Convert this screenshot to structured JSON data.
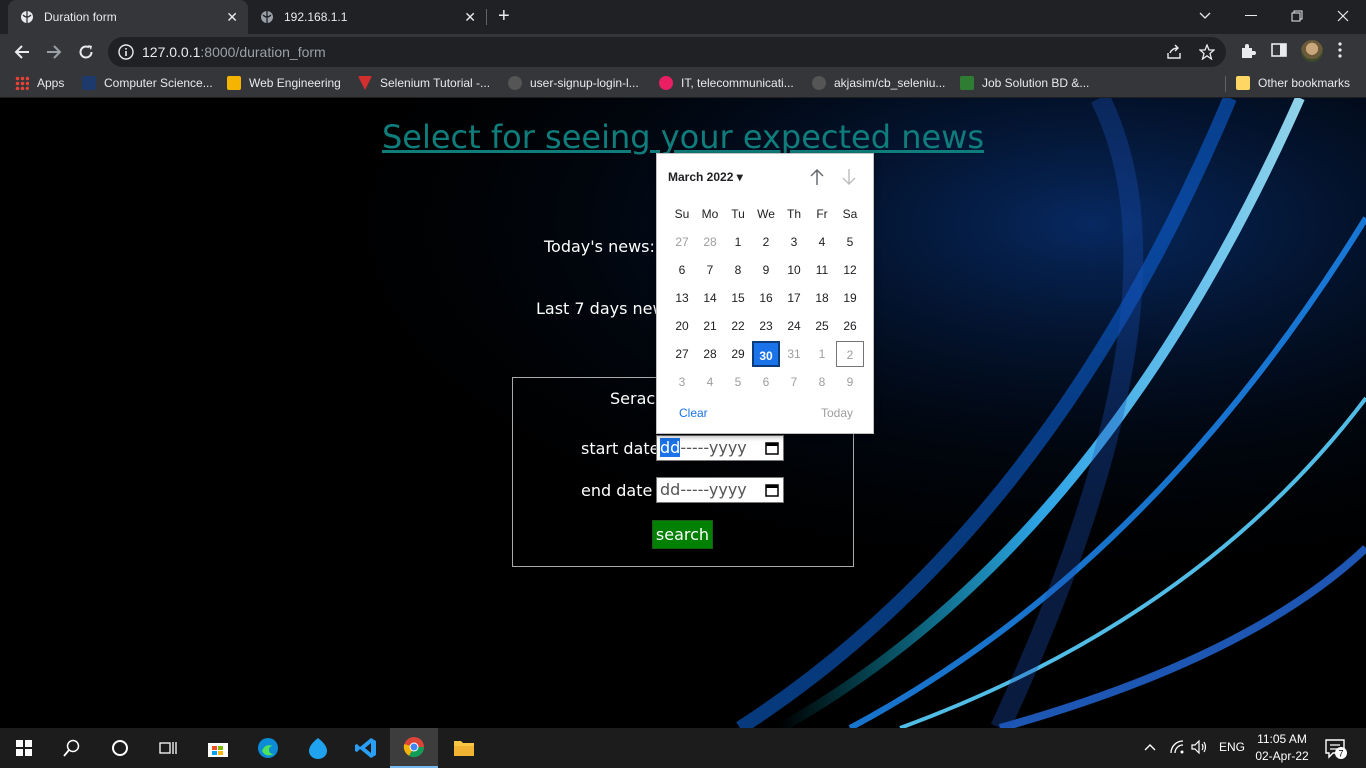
{
  "tabs": [
    {
      "title": "Duration form",
      "close": "✕"
    },
    {
      "title": "192.168.1.1",
      "close": "✕"
    }
  ],
  "new_tab": "+",
  "address": {
    "host": "127.0.0.1",
    "rest": ":8000/duration_form"
  },
  "bookmarks": [
    {
      "label": "Apps",
      "icon": "apps-grid-icon"
    },
    {
      "label": "Computer Science...",
      "icon": "sf-icon",
      "color": "#1e3a6d"
    },
    {
      "label": "Web Engineering",
      "icon": "classroom-icon",
      "color": "#f4b400"
    },
    {
      "label": "Selenium Tutorial -...",
      "icon": "v-icon",
      "color": "#d32f2f"
    },
    {
      "label": "user-signup-login-l...",
      "icon": "github-icon",
      "color": "#333333"
    },
    {
      "label": "IT, telecommunicati...",
      "icon": "it-icon",
      "color": "#e91e63"
    },
    {
      "label": "akjasim/cb_seleniu...",
      "icon": "github-icon",
      "color": "#333333"
    },
    {
      "label": "Job Solution BD &...",
      "icon": "job-icon",
      "color": "#2e7d32"
    }
  ],
  "other_bookmarks": "Other bookmarks",
  "page": {
    "title": "Select for seeing your expected news",
    "today_label": "Today's news:",
    "last7_label": "Last 7 days news:",
    "search_legend": "Serach",
    "start_label": "start date:",
    "end_label": "end date :",
    "start_value_selected": "dd",
    "start_value_rest": "-----yyyy",
    "end_value": "dd-----yyyy",
    "search_button": "search"
  },
  "picker": {
    "month_label": "March 2022",
    "dropdown": "▾",
    "weekdays": [
      "Su",
      "Mo",
      "Tu",
      "We",
      "Th",
      "Fr",
      "Sa"
    ],
    "weeks": [
      [
        {
          "d": "27",
          "o": true
        },
        {
          "d": "28",
          "o": true
        },
        {
          "d": "1"
        },
        {
          "d": "2"
        },
        {
          "d": "3"
        },
        {
          "d": "4"
        },
        {
          "d": "5"
        }
      ],
      [
        {
          "d": "6"
        },
        {
          "d": "7"
        },
        {
          "d": "8"
        },
        {
          "d": "9"
        },
        {
          "d": "10"
        },
        {
          "d": "11"
        },
        {
          "d": "12"
        }
      ],
      [
        {
          "d": "13"
        },
        {
          "d": "14"
        },
        {
          "d": "15"
        },
        {
          "d": "16"
        },
        {
          "d": "17"
        },
        {
          "d": "18"
        },
        {
          "d": "19"
        }
      ],
      [
        {
          "d": "20"
        },
        {
          "d": "21"
        },
        {
          "d": "22"
        },
        {
          "d": "23"
        },
        {
          "d": "24"
        },
        {
          "d": "25"
        },
        {
          "d": "26"
        }
      ],
      [
        {
          "d": "27"
        },
        {
          "d": "28"
        },
        {
          "d": "29"
        },
        {
          "d": "30",
          "sel": true
        },
        {
          "d": "31",
          "o": true
        },
        {
          "d": "1",
          "o": true
        },
        {
          "d": "2",
          "o": true,
          "today": true
        }
      ],
      [
        {
          "d": "3",
          "o": true
        },
        {
          "d": "4",
          "o": true
        },
        {
          "d": "5",
          "o": true
        },
        {
          "d": "6",
          "o": true
        },
        {
          "d": "7",
          "o": true
        },
        {
          "d": "8",
          "o": true
        },
        {
          "d": "9",
          "o": true
        }
      ]
    ],
    "clear": "Clear",
    "today": "Today"
  },
  "tray": {
    "lang": "ENG",
    "time": "11:05 AM",
    "date": "02-Apr-22",
    "notifications": "7"
  }
}
